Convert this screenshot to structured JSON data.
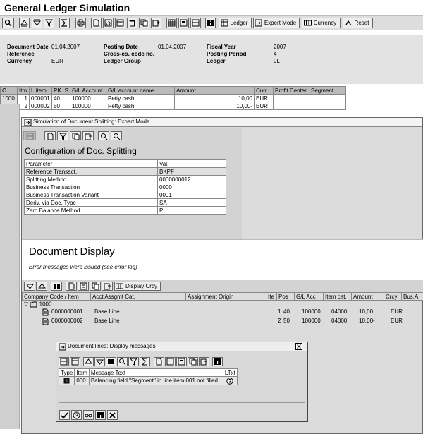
{
  "window": {
    "title": "General Ledger Simulation"
  },
  "toolbar": {
    "ledger": "Ledger",
    "expert_mode": "Expert Mode",
    "currency": "Currency",
    "reset": "Reset"
  },
  "header": {
    "document_date_label": "Document Date",
    "document_date": "01.04.2007",
    "posting_date_label": "Posting Date",
    "posting_date": "01.04.2007",
    "fiscal_year_label": "Fiscal Year",
    "fiscal_year": "2007",
    "reference_label": "Reference",
    "cross_co_label": "Cross-co. code no.",
    "posting_period_label": "Posting Period",
    "posting_period": "4",
    "currency_label": "Currency",
    "currency": "EUR",
    "ledger_group_label": "Ledger Group",
    "ledger_label": "Ledger",
    "ledger": "0L"
  },
  "main_table": {
    "columns": [
      "C..",
      "Itm",
      "L.item",
      "PK",
      "S",
      "G/L Account",
      "G/L account name",
      "Amount",
      "Curr.",
      "Profit Center",
      "Segment"
    ],
    "rows": [
      {
        "cc": "1000",
        "itm": "1",
        "litem": "000001",
        "pk": "40",
        "s": "",
        "gl": "100000",
        "name": "Petty cash",
        "amount": "10,00",
        "curr": "EUR"
      },
      {
        "cc": "",
        "itm": "2",
        "litem": "000002",
        "pk": "50",
        "s": "",
        "gl": "100000",
        "name": "Petty cash",
        "amount": "10,00-",
        "curr": "EUR"
      }
    ]
  },
  "split_dialog": {
    "title": "Simulation of Document Splitting: Expert Mode",
    "config_title": "Configuration of Doc. Splitting",
    "param_header": "Parameter",
    "value_header": "Val.",
    "params": [
      {
        "name": "Reference Transact.",
        "value": "BKPF"
      },
      {
        "name": "Splitting Method",
        "value": "0000000012"
      },
      {
        "name": "Business Transaction",
        "value": "0000"
      },
      {
        "name": "Business Transaction Variant",
        "value": "0001"
      },
      {
        "name": "Deriv. via Doc. Type",
        "value": "SA"
      },
      {
        "name": "Zero Balance Method",
        "value": "P"
      }
    ],
    "doc_display_title": "Document Display",
    "doc_error": "Error messages were issued (see error log)",
    "display_crcy": "Display Crcy",
    "doc_columns": [
      "Company Code / Item",
      "Acct Assgmt Cat.",
      "Assignment Origin",
      "Ite",
      "Pos",
      "G/L Acc",
      "Item cat.",
      "Amount",
      "Crcy",
      "Bus.A"
    ],
    "tree_root": "1000",
    "doc_rows": [
      {
        "id": "0000000001",
        "cat": "Base Line",
        "ite": "1",
        "pos": "40",
        "gl": "100000",
        "icat": "04000",
        "amount": "10,00",
        "crcy": "EUR"
      },
      {
        "id": "0000000002",
        "cat": "Base Line",
        "ite": "2",
        "pos": "50",
        "gl": "100000",
        "icat": "04000",
        "amount": "10,00-",
        "crcy": "EUR"
      }
    ]
  },
  "msg_dialog": {
    "title": "Document lines: Display messages",
    "columns": [
      "Type",
      "Item",
      "Message Text",
      "LTxt"
    ],
    "rows": [
      {
        "type": "error",
        "item": "000",
        "text": "Balancing field \"Segment\" in line item 001 not filled"
      }
    ]
  }
}
